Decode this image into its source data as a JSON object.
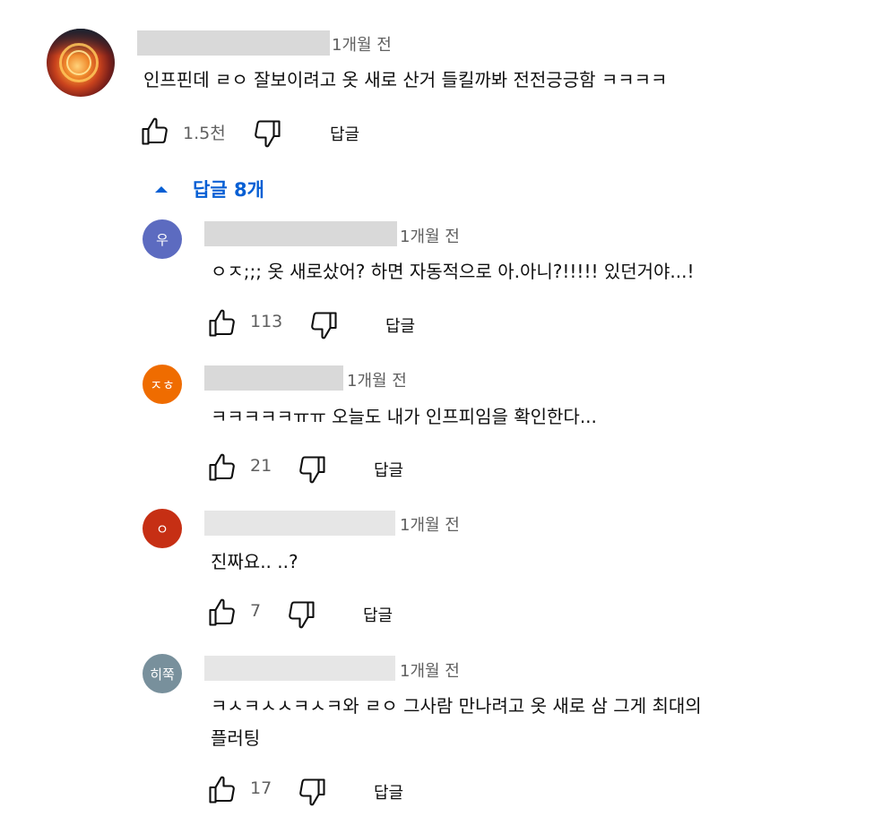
{
  "main_comment": {
    "time": "1개월 전",
    "text": "인프핀데 ㄹㅇ 잘보이려고 옷 새로 산거 들킬까봐 전전긍긍함 ㅋㅋㅋㅋ",
    "likes": "1.5천",
    "reply_label": "답글"
  },
  "replies_toggle": {
    "label": "답글 8개",
    "icon": "triangle-up-icon"
  },
  "replies": [
    {
      "avatar_initial": "우",
      "avatar_color": "#5c6bc0",
      "time": "1개월 전",
      "text": "ㅇㅈ;;; 옷 새로샀어? 하면 자동적으로 아.아니?!!!!! 있던거야...!",
      "likes": "113",
      "reply_label": "답글"
    },
    {
      "avatar_initial": "ㅈㅎ",
      "avatar_color": "#ef6c00",
      "time": "1개월 전",
      "text": "ㅋㅋㅋㅋㅋㅠㅠ 오늘도 내가 인프피임을 확인한다...",
      "likes": "21",
      "reply_label": "답글"
    },
    {
      "avatar_initial": "ㅇ",
      "avatar_color": "#c62f14",
      "time": "1개월 전",
      "text": "진짜요..  ..?",
      "likes": "7",
      "reply_label": "답글"
    },
    {
      "avatar_initial": "히쭉",
      "avatar_color": "#78909c",
      "time": "1개월 전",
      "text_line1": "ㅋㅅㅋㅅㅅㅋㅅㅋ와 ㄹㅇ 그사람 만나려고 옷 새로 삼 그게 최대의",
      "text_line2": "플러팅",
      "likes": "17",
      "reply_label": "답글"
    }
  ],
  "icons": {
    "like": "thumbs-up-icon",
    "dislike": "thumbs-down-icon"
  },
  "colors": {
    "link_blue": "#065fd4",
    "meta_gray": "#606060"
  }
}
